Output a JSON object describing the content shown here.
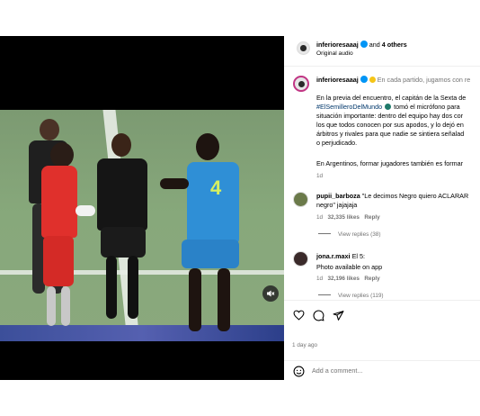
{
  "header": {
    "username": "inferioresaaaj",
    "collab_text": "and",
    "collab_others": "4 others",
    "audio": "Original audio"
  },
  "caption": {
    "username": "inferioresaaaj",
    "first_line": "En cada partido, jugamos con re",
    "lines": [
      "En la previa del encuentro, el capitán de la Sexta de",
      "tomó el micrófono para",
      "situación importante: dentro del equipo hay dos cor",
      "los que todos conocen por sus apodos, y lo dejó en",
      "árbitros y rivales para que nadie se sintiera señalad",
      "o perjudicado."
    ],
    "hashtag": "#ElSemilleroDelMundo",
    "closing": "En Argentinos, formar jugadores también es formar",
    "time": "1d"
  },
  "comments": [
    {
      "username": "pupii_barboza",
      "text_line1": "\"Le decimos Negro quiero ACLARAR",
      "text_line2": "negro\" jajajaja",
      "time": "1d",
      "likes": "32,335 likes",
      "reply": "Reply",
      "view_replies": "View replies (38)"
    },
    {
      "username": "jona.r.maxi",
      "text_line1": "El 5:",
      "text_line2": "Photo available on app",
      "time": "1d",
      "likes": "32,196 likes",
      "reply": "Reply",
      "view_replies": "View replies (119)"
    }
  ],
  "post_time": "1 day ago",
  "add_comment_placeholder": "Add a comment...",
  "video": {
    "jersey_number": "4"
  },
  "colors": {
    "verified": "#0095f6",
    "link": "#00376b",
    "muted_text": "#737373"
  },
  "icons": [
    "heart-icon",
    "comment-icon",
    "share-icon",
    "emoji-icon",
    "mute-icon",
    "verified-icon"
  ]
}
